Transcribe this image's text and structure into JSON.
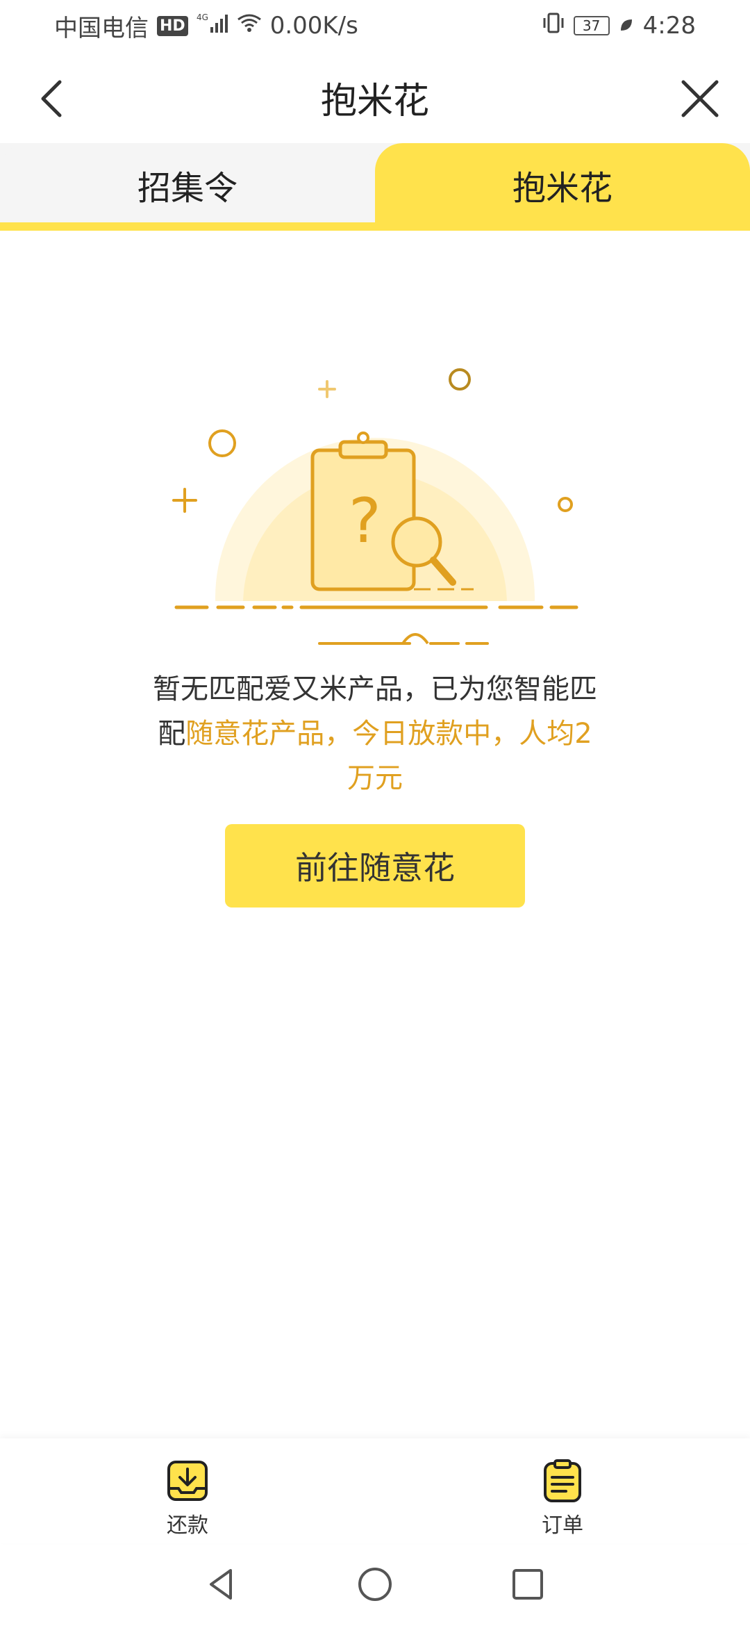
{
  "status_bar": {
    "carrier": "中国电信",
    "hd": "HD",
    "network": "4G",
    "speed": "0.00K/s",
    "battery": "37",
    "time": "4:28"
  },
  "header": {
    "title": "抱米花"
  },
  "tabs": [
    {
      "label": "招集令",
      "active": false
    },
    {
      "label": "抱米花",
      "active": true
    }
  ],
  "empty_state": {
    "line_normal_1": "暂无匹配爱又米产品，已为您智能匹配",
    "line_highlight": "随意花产品，今日放款中，人均2万元",
    "button_label": "前往随意花"
  },
  "bottom_nav": {
    "repay_label": "还款",
    "orders_label": "订单"
  },
  "colors": {
    "accent": "#ffe24c",
    "highlight": "#e0a020"
  }
}
